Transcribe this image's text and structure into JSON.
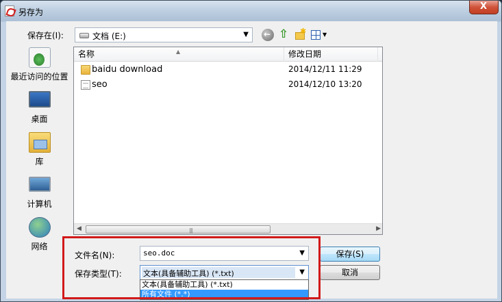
{
  "window": {
    "title": "另存为",
    "close_label": "X"
  },
  "address": {
    "label": "保存在(I):",
    "value": "文档 (E:)",
    "drive_icon": "drive-icon"
  },
  "toolbar": {
    "back_icon": "back-icon",
    "up_icon": "up-folder-icon",
    "new_folder_icon": "new-folder-icon",
    "view_icon": "view-menu-icon"
  },
  "places": [
    {
      "label": "最近访问的位置",
      "icon": "recent-places-icon"
    },
    {
      "label": "桌面",
      "icon": "desktop-icon"
    },
    {
      "label": "库",
      "icon": "library-icon"
    },
    {
      "label": "计算机",
      "icon": "computer-icon"
    },
    {
      "label": "网络",
      "icon": "network-icon"
    }
  ],
  "columns": {
    "name": "名称",
    "date": "修改日期",
    "extra": "["
  },
  "files": [
    {
      "name": "baidu download",
      "date": "2014/12/11 11:29",
      "type": "folder"
    },
    {
      "name": "seo",
      "date": "2014/12/10 13:20",
      "type": "document"
    }
  ],
  "filename": {
    "label": "文件名(N):",
    "value": "seo.doc"
  },
  "filetype": {
    "label": "保存类型(T):",
    "value": "文本(具备辅助工具) (*.txt)",
    "options": [
      "文本(具备辅助工具) (*.txt)",
      "所有文件 (*.*)"
    ],
    "highlighted_index": 1
  },
  "buttons": {
    "save": "保存(S)",
    "cancel": "取消"
  },
  "colors": {
    "highlight_box": "#d11919",
    "selection": "#3399ff"
  }
}
